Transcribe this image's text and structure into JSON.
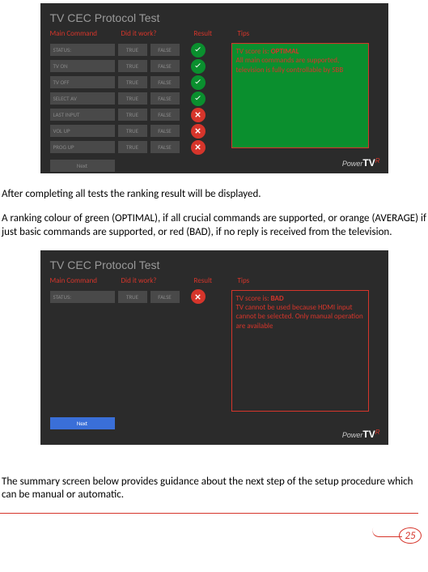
{
  "screenshot1": {
    "title": "TV CEC Protocol Test",
    "headers": {
      "cmd": "Main Command",
      "work": "Did it work?",
      "result": "Result",
      "tips": "Tips"
    },
    "true_label": "TRUE",
    "false_label": "FALSE",
    "rows": [
      {
        "label": "STATUS:",
        "result": "ok"
      },
      {
        "label": "TV ON",
        "result": "ok"
      },
      {
        "label": "TV OFF",
        "result": "ok"
      },
      {
        "label": "SELECT AV",
        "result": "ok"
      },
      {
        "label": "LAST INPUT",
        "result": "bad"
      },
      {
        "label": "VOL UP",
        "result": "bad"
      },
      {
        "label": "PROG UP",
        "result": "bad"
      }
    ],
    "next_label": "Next",
    "tips": {
      "prefix": "TV score is: ",
      "score": "OPTIMAL",
      "text": "All main commands are supported, television is fully controllable by SBB"
    },
    "logo": {
      "power": "Power",
      "tv": "TV",
      "r": "R"
    }
  },
  "para1": "After completing all tests the ranking result will be displayed.",
  "para2": "A ranking colour of green (OPTIMAL), if all crucial commands are  supported, or orange (AVERAGE) if just basic commands are supported, or red (BAD), if no reply is received from the television.",
  "screenshot2": {
    "title": "TV CEC Protocol Test",
    "headers": {
      "cmd": "Main Command",
      "work": "Did it work?",
      "result": "Result",
      "tips": "Tips"
    },
    "true_label": "TRUE",
    "false_label": "FALSE",
    "rows": [
      {
        "label": "STATUS:",
        "result": "bad"
      }
    ],
    "next_label": "Next",
    "tips": {
      "prefix": "TV score is: ",
      "score": "BAD",
      "text": "TV cannot be used because HDMI input cannot be selected. Only manual operation are available"
    },
    "logo": {
      "power": "Power",
      "tv": "TV",
      "r": "R"
    }
  },
  "para3": "The summary screen below provides guidance about the next step of the setup procedure which can be manual or automatic.",
  "page_number": "25"
}
